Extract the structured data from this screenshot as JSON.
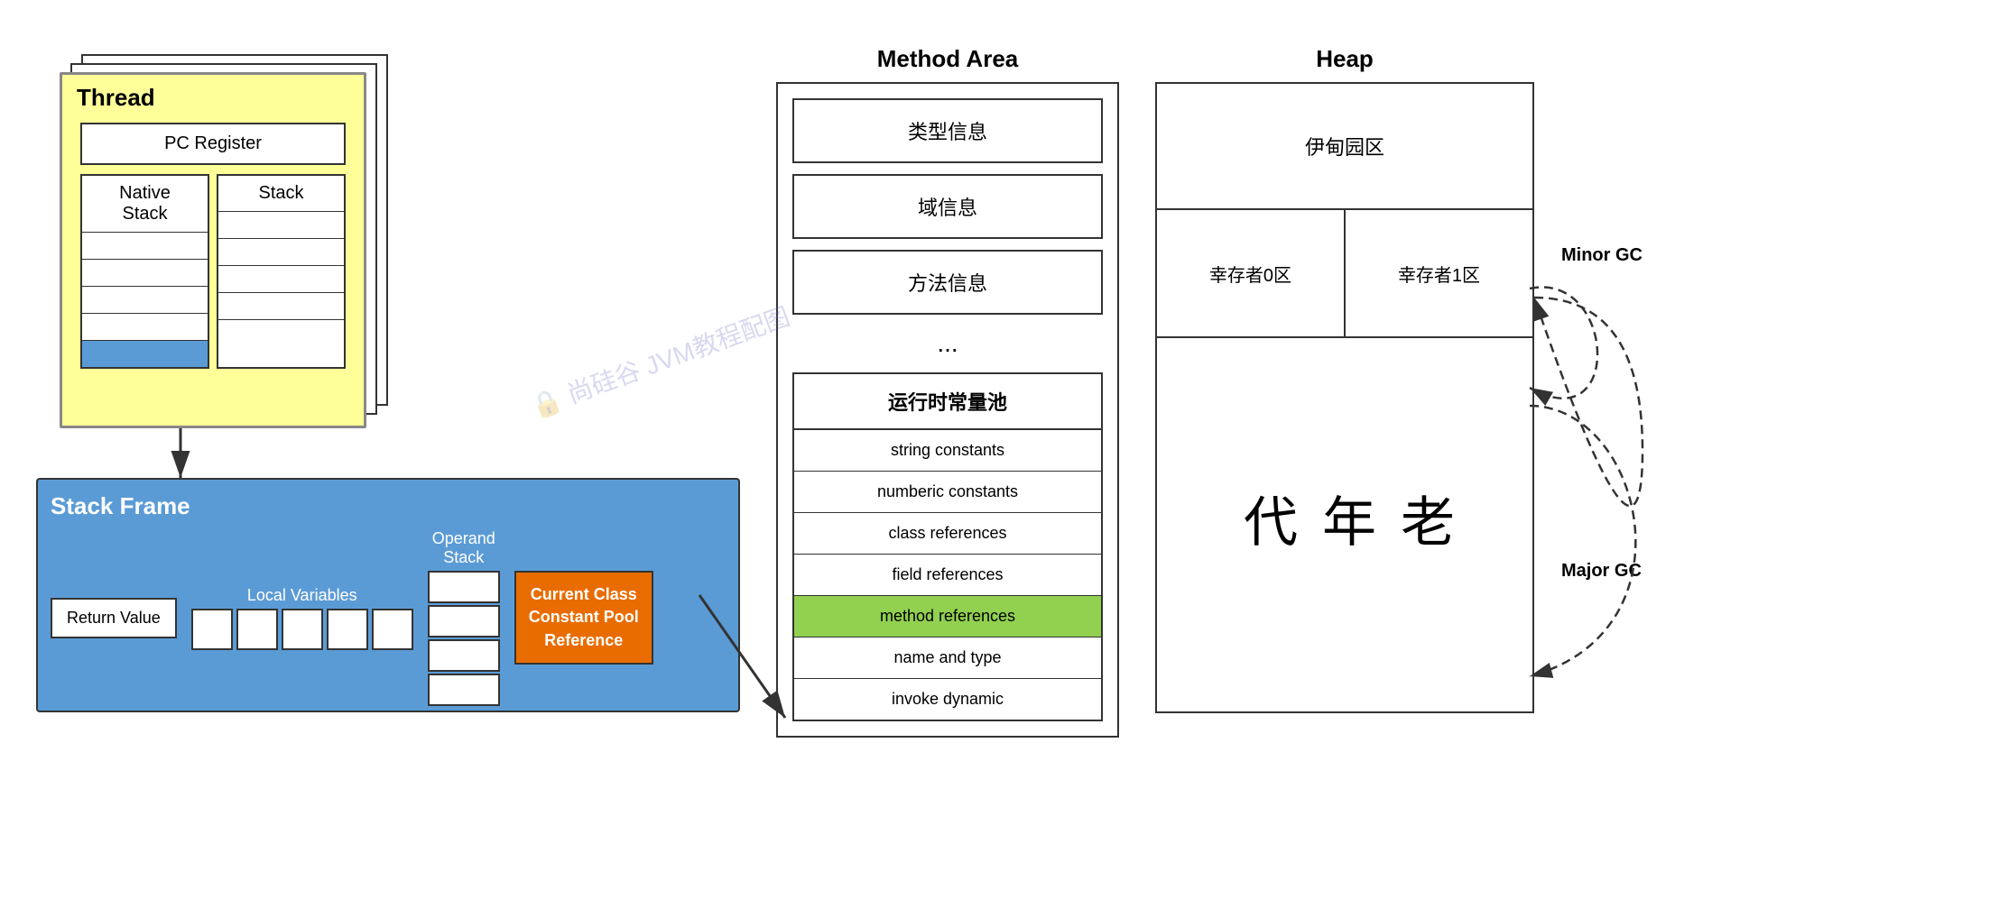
{
  "thread": {
    "title": "Thread",
    "pc_register": "PC Register",
    "native_stack": "Native\nStack",
    "stack": "Stack"
  },
  "stack_frame": {
    "title": "Stack Frame",
    "local_variables_label": "Local Variables",
    "return_value": "Return Value",
    "operand_stack_label": "Operand\nStack",
    "current_class": "Current Class\nConstant Pool\nReference"
  },
  "method_area": {
    "title": "Method Area",
    "items": [
      {
        "label": "类型信息"
      },
      {
        "label": "域信息"
      },
      {
        "label": "方法信息"
      }
    ],
    "dots": "...",
    "runtime_pool_title": "运行时常量池",
    "pool_items": [
      {
        "label": "string constants",
        "highlight": false
      },
      {
        "label": "numberic constants",
        "highlight": false
      },
      {
        "label": "class references",
        "highlight": false
      },
      {
        "label": "field references",
        "highlight": false
      },
      {
        "label": "method references",
        "highlight": true
      },
      {
        "label": "name and type",
        "highlight": false
      },
      {
        "label": "invoke dynamic",
        "highlight": false
      }
    ]
  },
  "heap": {
    "title": "Heap",
    "eden": "伊甸园区",
    "survivor0": "幸存者0区",
    "survivor1": "幸存者1区",
    "old_gen": "老\n年\n代"
  },
  "gc": {
    "minor_gc": "Minor\nGC",
    "major_gc": "Major\nGC"
  },
  "watermark": "尚硅谷 JVM教程配图"
}
